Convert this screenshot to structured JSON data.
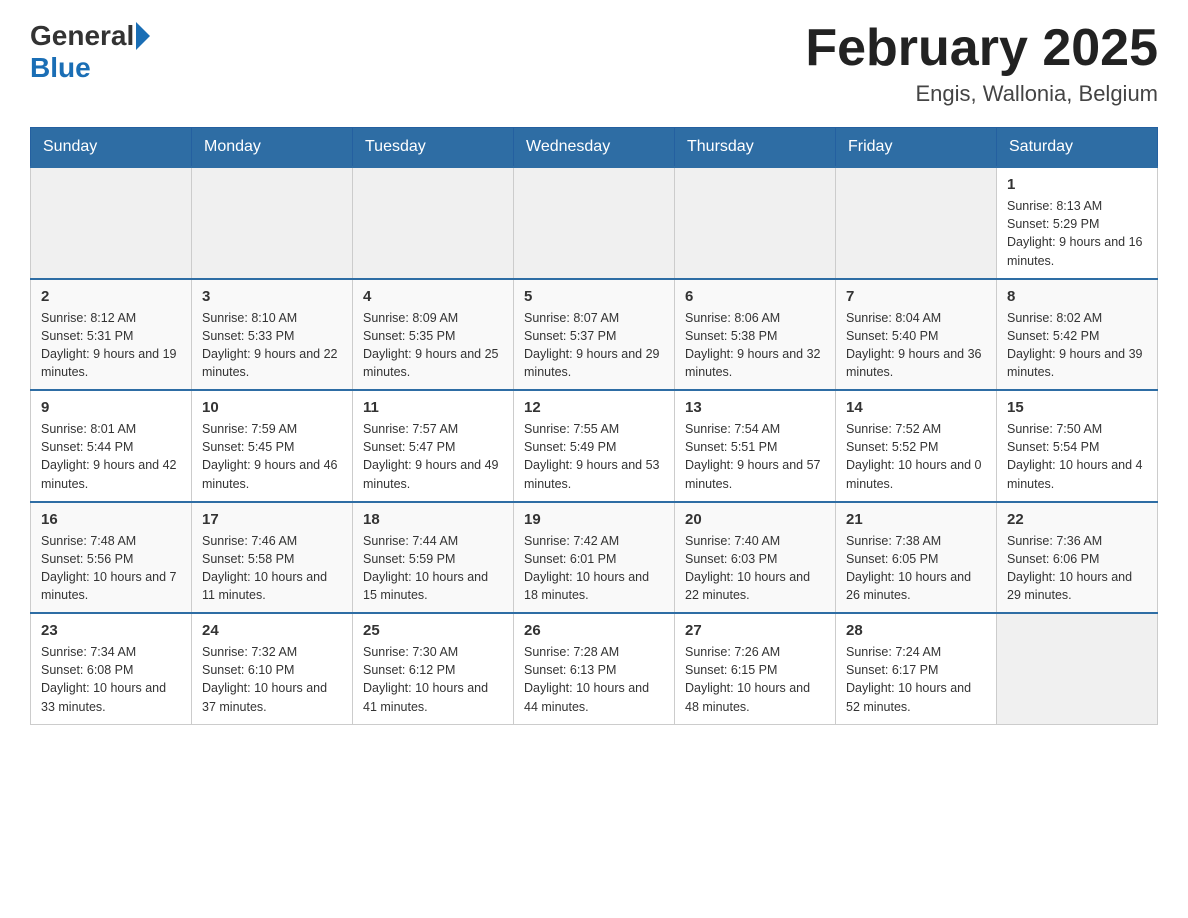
{
  "header": {
    "logo_general": "General",
    "logo_blue": "Blue",
    "title": "February 2025",
    "subtitle": "Engis, Wallonia, Belgium"
  },
  "days_of_week": [
    "Sunday",
    "Monday",
    "Tuesday",
    "Wednesday",
    "Thursday",
    "Friday",
    "Saturday"
  ],
  "weeks": [
    [
      {
        "day": "",
        "info": ""
      },
      {
        "day": "",
        "info": ""
      },
      {
        "day": "",
        "info": ""
      },
      {
        "day": "",
        "info": ""
      },
      {
        "day": "",
        "info": ""
      },
      {
        "day": "",
        "info": ""
      },
      {
        "day": "1",
        "info": "Sunrise: 8:13 AM\nSunset: 5:29 PM\nDaylight: 9 hours and 16 minutes."
      }
    ],
    [
      {
        "day": "2",
        "info": "Sunrise: 8:12 AM\nSunset: 5:31 PM\nDaylight: 9 hours and 19 minutes."
      },
      {
        "day": "3",
        "info": "Sunrise: 8:10 AM\nSunset: 5:33 PM\nDaylight: 9 hours and 22 minutes."
      },
      {
        "day": "4",
        "info": "Sunrise: 8:09 AM\nSunset: 5:35 PM\nDaylight: 9 hours and 25 minutes."
      },
      {
        "day": "5",
        "info": "Sunrise: 8:07 AM\nSunset: 5:37 PM\nDaylight: 9 hours and 29 minutes."
      },
      {
        "day": "6",
        "info": "Sunrise: 8:06 AM\nSunset: 5:38 PM\nDaylight: 9 hours and 32 minutes."
      },
      {
        "day": "7",
        "info": "Sunrise: 8:04 AM\nSunset: 5:40 PM\nDaylight: 9 hours and 36 minutes."
      },
      {
        "day": "8",
        "info": "Sunrise: 8:02 AM\nSunset: 5:42 PM\nDaylight: 9 hours and 39 minutes."
      }
    ],
    [
      {
        "day": "9",
        "info": "Sunrise: 8:01 AM\nSunset: 5:44 PM\nDaylight: 9 hours and 42 minutes."
      },
      {
        "day": "10",
        "info": "Sunrise: 7:59 AM\nSunset: 5:45 PM\nDaylight: 9 hours and 46 minutes."
      },
      {
        "day": "11",
        "info": "Sunrise: 7:57 AM\nSunset: 5:47 PM\nDaylight: 9 hours and 49 minutes."
      },
      {
        "day": "12",
        "info": "Sunrise: 7:55 AM\nSunset: 5:49 PM\nDaylight: 9 hours and 53 minutes."
      },
      {
        "day": "13",
        "info": "Sunrise: 7:54 AM\nSunset: 5:51 PM\nDaylight: 9 hours and 57 minutes."
      },
      {
        "day": "14",
        "info": "Sunrise: 7:52 AM\nSunset: 5:52 PM\nDaylight: 10 hours and 0 minutes."
      },
      {
        "day": "15",
        "info": "Sunrise: 7:50 AM\nSunset: 5:54 PM\nDaylight: 10 hours and 4 minutes."
      }
    ],
    [
      {
        "day": "16",
        "info": "Sunrise: 7:48 AM\nSunset: 5:56 PM\nDaylight: 10 hours and 7 minutes."
      },
      {
        "day": "17",
        "info": "Sunrise: 7:46 AM\nSunset: 5:58 PM\nDaylight: 10 hours and 11 minutes."
      },
      {
        "day": "18",
        "info": "Sunrise: 7:44 AM\nSunset: 5:59 PM\nDaylight: 10 hours and 15 minutes."
      },
      {
        "day": "19",
        "info": "Sunrise: 7:42 AM\nSunset: 6:01 PM\nDaylight: 10 hours and 18 minutes."
      },
      {
        "day": "20",
        "info": "Sunrise: 7:40 AM\nSunset: 6:03 PM\nDaylight: 10 hours and 22 minutes."
      },
      {
        "day": "21",
        "info": "Sunrise: 7:38 AM\nSunset: 6:05 PM\nDaylight: 10 hours and 26 minutes."
      },
      {
        "day": "22",
        "info": "Sunrise: 7:36 AM\nSunset: 6:06 PM\nDaylight: 10 hours and 29 minutes."
      }
    ],
    [
      {
        "day": "23",
        "info": "Sunrise: 7:34 AM\nSunset: 6:08 PM\nDaylight: 10 hours and 33 minutes."
      },
      {
        "day": "24",
        "info": "Sunrise: 7:32 AM\nSunset: 6:10 PM\nDaylight: 10 hours and 37 minutes."
      },
      {
        "day": "25",
        "info": "Sunrise: 7:30 AM\nSunset: 6:12 PM\nDaylight: 10 hours and 41 minutes."
      },
      {
        "day": "26",
        "info": "Sunrise: 7:28 AM\nSunset: 6:13 PM\nDaylight: 10 hours and 44 minutes."
      },
      {
        "day": "27",
        "info": "Sunrise: 7:26 AM\nSunset: 6:15 PM\nDaylight: 10 hours and 48 minutes."
      },
      {
        "day": "28",
        "info": "Sunrise: 7:24 AM\nSunset: 6:17 PM\nDaylight: 10 hours and 52 minutes."
      },
      {
        "day": "",
        "info": ""
      }
    ]
  ]
}
